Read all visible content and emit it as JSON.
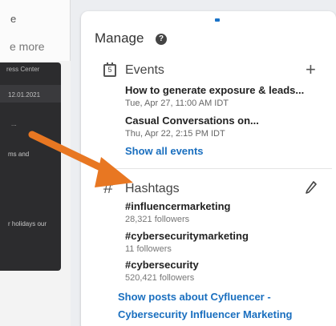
{
  "left_column": {
    "top_fragment": "e",
    "more_label": "e more",
    "press_center": "ress Center",
    "date": "12.01.2021",
    "snippet_1": "...",
    "snippet_2": "ms and",
    "snippet_3": "r holidays our"
  },
  "manage": {
    "title": "Manage",
    "help_icon": "question-circle-icon"
  },
  "events": {
    "title": "Events",
    "icon": "calendar-icon",
    "add_icon": "plus-icon",
    "items": [
      {
        "name": "How to generate exposure & leads...",
        "time": "Tue, Apr 27, 11:00 AM IDT"
      },
      {
        "name": "Casual Conversations on...",
        "time": "Thu, Apr 22, 2:15 PM IDT"
      }
    ],
    "show_all": "Show all events"
  },
  "hashtags": {
    "title": "Hashtags",
    "icon": "hash-icon",
    "edit_icon": "pencil-icon",
    "items": [
      {
        "tag": "#influencermarketing",
        "followers": "28,321 followers"
      },
      {
        "tag": "#cybersecuritymarketing",
        "followers": "11 followers"
      },
      {
        "tag": "#cybersecurity",
        "followers": "520,421 followers"
      }
    ],
    "show_posts_line1": "Show posts about Cyfluencer -",
    "show_posts_line2": "Cybersecurity Influencer Marketing"
  },
  "colors": {
    "link": "#1a6fbf",
    "arrow": "#e87722",
    "dark_card": "#2c2c2e"
  }
}
